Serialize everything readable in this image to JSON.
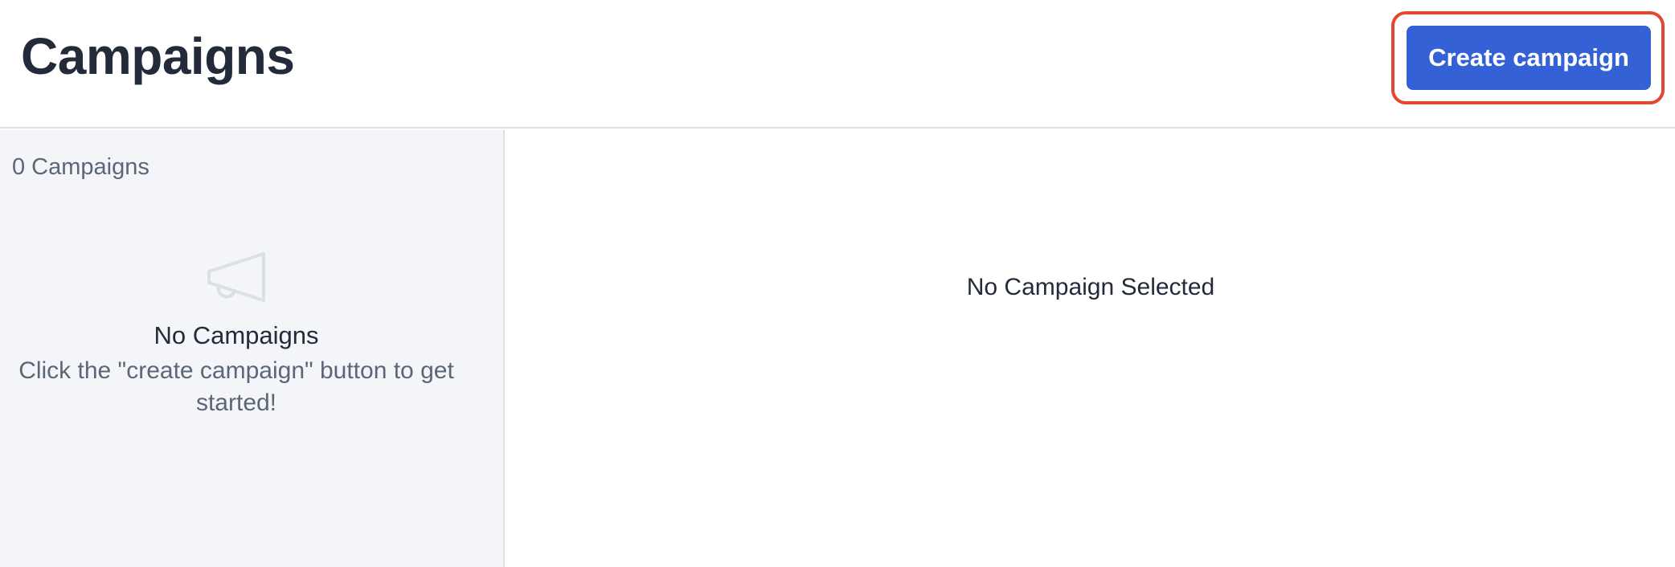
{
  "header": {
    "title": "Campaigns",
    "create_button_label": "Create campaign"
  },
  "sidebar": {
    "count_label": "0 Campaigns",
    "empty_state": {
      "icon": "megaphone-icon",
      "title": "No Campaigns",
      "help_text": "Click the \"create campaign\" button to get started!"
    }
  },
  "main": {
    "empty_message": "No Campaign Selected"
  },
  "colors": {
    "accent": "#3461d6",
    "highlight": "#e2472f",
    "sidebar_bg": "#f3f5f9"
  }
}
